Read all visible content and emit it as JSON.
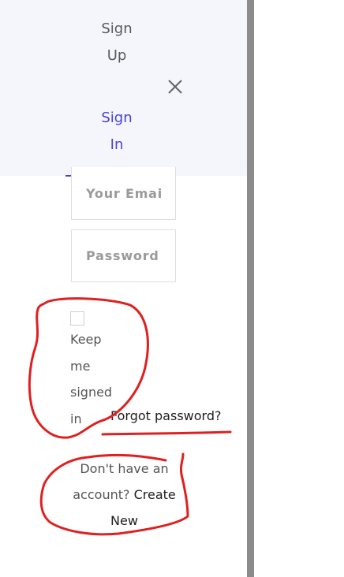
{
  "menu": {
    "signup_line1": "Sign",
    "signup_line2": "Up",
    "signin_line1": "Sign",
    "signin_line2": "In",
    "close_icon": "close-icon",
    "signin_color": "#4b3fd6",
    "panel_bg": "#f4f6fc"
  },
  "form": {
    "email_placeholder": "Your Emai",
    "password_placeholder": "Password",
    "keep_signed_in_words": [
      "Keep",
      "me",
      "signed",
      "in"
    ],
    "forgot_password": "Forgot password?"
  },
  "signup_prompt": {
    "text_line1": "Don't have an",
    "text_line2a": "account?",
    "create_new_a": "Create",
    "create_new_b": "New"
  },
  "annotation": {
    "color": "#e02020"
  }
}
